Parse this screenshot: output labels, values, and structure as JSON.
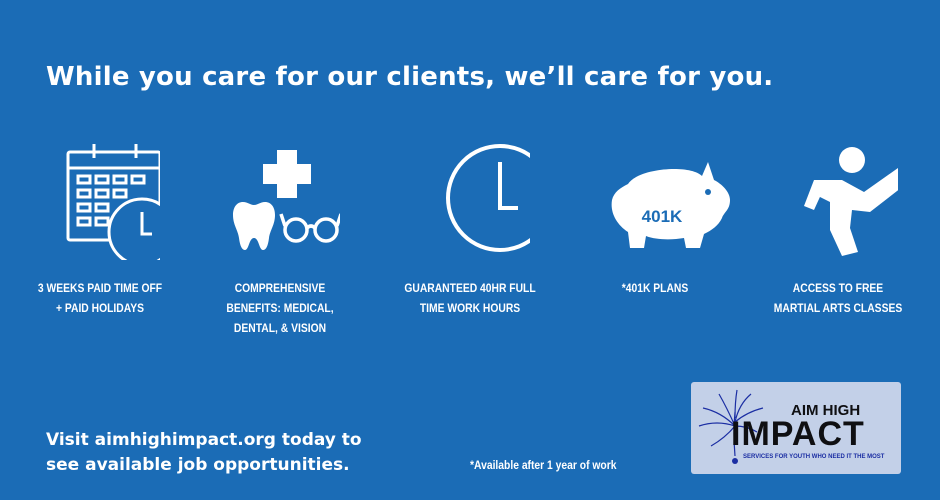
{
  "headline": "While you care for our clients, we’ll care for you.",
  "colors": {
    "background": "#1b6cb6",
    "text": "#ffffff",
    "logo_box": "#c3d0e8",
    "logo_text": "#0f0f12",
    "logo_tagline": "#1b2ea3"
  },
  "benefits": [
    {
      "icon": "calendar-clock-icon",
      "label": "3 Weeks Paid Time Off\n+ Paid Holidays"
    },
    {
      "icon": "medical-dental-vision-icon",
      "label": "Comprehensive\nBenefits: Medical,\nDental, & Vision"
    },
    {
      "icon": "clock-icon",
      "label": "Guaranteed 40HR Full\nTime Work Hours"
    },
    {
      "icon": "piggy-bank-icon",
      "label": "*401K Plans",
      "icon_text": "401K"
    },
    {
      "icon": "martial-arts-kick-icon",
      "label": "Access to Free\nMartial Arts Classes"
    }
  ],
  "cta": "Visit aimhighimpact.org today to\nsee available job opportunities.",
  "footnote": "*Available after 1 year of work",
  "logo": {
    "line1": "AIM HIGH",
    "line2": "IMPACT",
    "tagline": "SERVICES FOR YOUTH WHO NEED IT THE MOST"
  }
}
